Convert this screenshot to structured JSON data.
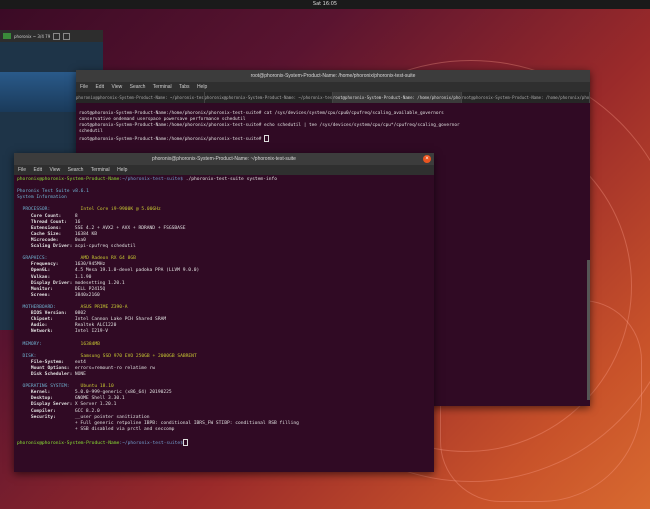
{
  "topbar": {
    "clock": "Sat 16:05"
  },
  "mini_window": {
    "label": "phoronix ~ 3/4 79"
  },
  "back_terminal": {
    "title": "root@phoronix-System-Product-Name: /home/phoronix/phoronix-test-suite",
    "menu": [
      "File",
      "Edit",
      "View",
      "Search",
      "Terminal",
      "Tabs",
      "Help"
    ],
    "tabs": [
      "phoronix@phoronix-System-Product-Name: ~/phoronix-test-suite",
      "phoronix@phoronix-System-Product-Name: ~/phoronix-test-suite",
      "root@phoronix-System-Product-Name: /home/phoronix/phoronix-test-suite",
      "root@phoronix-System-Product-Name: /home/phoronix/phoronix-test-suite"
    ],
    "lines": [
      "root@phoronix-System-Product-Name:/home/phoronix/phoronix-test-suite# cat /sys/devices/system/cpu/cpu0/cpufreq/scaling_available_governors",
      "conservative ondemand userspace powersave performance schedutil",
      "root@phoronix-System-Product-Name:/home/phoronix/phoronix-test-suite# echo schedutil | tee /sys/devices/system/cpu/cpu*/cpufreq/scaling_governor",
      "schedutil",
      "root@phoronix-System-Product-Name:/home/phoronix/phoronix-test-suite# "
    ]
  },
  "front_terminal": {
    "title": "phoronix@phoronix-System-Product-Name: ~/phoronix-test-suite",
    "menu": [
      "File",
      "Edit",
      "View",
      "Search",
      "Terminal",
      "Help"
    ],
    "prompt_user": "phoronix@phoronix-System-Product-Name",
    "prompt_path": ":~/phoronix-test-suite$",
    "command": " ./phoronix-test-suite system-info",
    "heading1": "Phoronix Test Suite v8.6.1",
    "heading2": "System Information",
    "sections": [
      {
        "name": "PROCESSOR:",
        "value": "Intel Core i9-9900K @ 5.00GHz",
        "rows": [
          [
            "Core Count:",
            "8"
          ],
          [
            "Thread Count:",
            "16"
          ],
          [
            "Extensions:",
            "SSE 4.2 + AVX2 + AVX + RDRAND + FSGSBASE"
          ],
          [
            "Cache Size:",
            "16384 KB"
          ],
          [
            "Microcode:",
            "0xa0"
          ],
          [
            "Scaling Driver:",
            "acpi-cpufreq schedutil"
          ]
        ]
      },
      {
        "name": "GRAPHICS:",
        "value": "AMD Radeon RX 64 8GB",
        "rows": [
          [
            "Frequency:",
            "1630/945MHz"
          ],
          [
            "OpenGL:",
            "4.5 Mesa 19.1.0-devel padoka PPA (LLVM 9.0.0)"
          ],
          [
            "Vulkan:",
            "1.1.90"
          ],
          [
            "Display Driver:",
            "modesetting 1.20.1"
          ],
          [
            "Monitor:",
            "DELL P2415Q"
          ],
          [
            "Screen:",
            "3840x2160"
          ]
        ]
      },
      {
        "name": "MOTHERBOARD:",
        "value": "ASUS PRIME Z390-A",
        "rows": [
          [
            "BIOS Version:",
            "0802"
          ],
          [
            "Chipset:",
            "Intel Cannon Lake PCH Shared SRAM"
          ],
          [
            "Audio:",
            "Realtek ALC1220"
          ],
          [
            "Network:",
            "Intel I219-V"
          ]
        ]
      },
      {
        "name": "MEMORY:",
        "value": "16384MB",
        "rows": []
      },
      {
        "name": "DISK:",
        "value": "Samsung SSD 970 EVO 250GB + 2000GB SABRENT",
        "rows": [
          [
            "File-System:",
            "ext4"
          ],
          [
            "Mount Options:",
            "errors=remount-ro relatime rw"
          ],
          [
            "Disk Scheduler:",
            "NONE"
          ]
        ]
      },
      {
        "name": "OPERATING SYSTEM:",
        "value": "Ubuntu 18.10",
        "rows": [
          [
            "Kernel:",
            "5.0.0-999-generic (x86_64) 20190225"
          ],
          [
            "Desktop:",
            "GNOME Shell 3.30.1"
          ],
          [
            "Display Server:",
            "X Server 1.20.1"
          ],
          [
            "Compiler:",
            "GCC 8.2.0"
          ],
          [
            "Security:",
            "__user pointer sanitization"
          ],
          [
            "",
            "+ Full generic retpoline IBPB: conditional IBRS_FW STIBP: conditional RSB filling"
          ],
          [
            "",
            "+ SSB disabled via prctl and seccomp"
          ]
        ]
      }
    ]
  }
}
